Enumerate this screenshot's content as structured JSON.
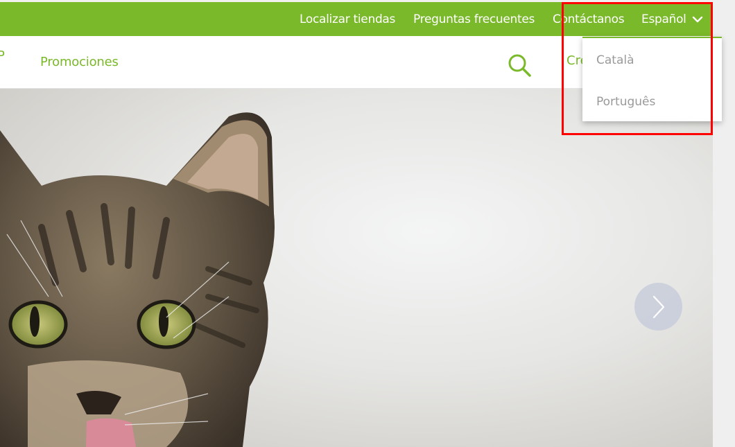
{
  "topbar": {
    "store_locator": "Localizar tiendas",
    "faq": "Preguntas frecuentes",
    "contact": "Contáctanos",
    "language": "Español"
  },
  "navbar": {
    "partial_left": "P",
    "promotions": "Promociones",
    "partial_right": "Cre"
  },
  "language_menu": {
    "options": [
      "Català",
      "Português"
    ]
  },
  "colors": {
    "brand_green": "#7ab929",
    "highlight": "#ff0000"
  },
  "icons": {
    "search": "search-icon",
    "chevron": "chevron-down-icon",
    "next": "chevron-right-icon"
  }
}
